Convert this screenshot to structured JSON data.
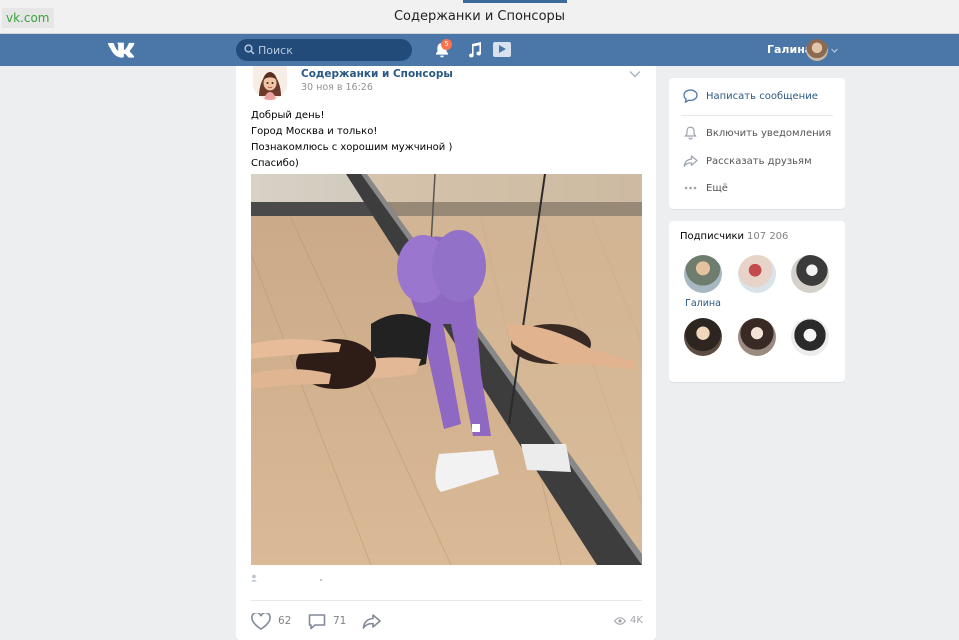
{
  "browser": {
    "url": "vk.com",
    "window_title": "Содержанки и Спонсоры"
  },
  "header": {
    "logo": "vk-logo",
    "search_placeholder": "Поиск",
    "notification_count": "5",
    "user_name": "Галина"
  },
  "post": {
    "group_name": "Содержанки и Спонсоры",
    "date": "30 ноя в 16:26",
    "text_lines": [
      "Добрый день!",
      "Город Москва и только!",
      "Познакомлюсь с хорошим мужчиной )",
      "Спасибо)"
    ],
    "likes": "62",
    "comments": "71",
    "views": "4K"
  },
  "sidebar": {
    "actions": [
      {
        "label": "Написать сообщение",
        "icon": "message-icon"
      },
      {
        "label": "Включить уведомления",
        "icon": "bell-icon"
      },
      {
        "label": "Рассказать друзьям",
        "icon": "share-icon"
      },
      {
        "label": "Ещё",
        "icon": "more-icon"
      }
    ],
    "subscribers": {
      "title": "Подписчики",
      "count": "107 206",
      "first_name": "Галина"
    }
  },
  "colors": {
    "vk_blue": "#4a76a8",
    "link": "#2a5885",
    "page_bg": "#edeef0"
  }
}
